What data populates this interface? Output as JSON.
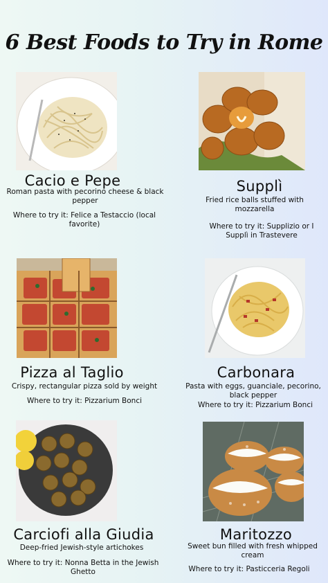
{
  "title": "6 Best Foods to Try in Rome",
  "items": [
    {
      "name": "Cacio e Pepe",
      "desc": "Roman pasta with pecorino cheese & black pepper",
      "where": "Where to try it: Felice a Testaccio (local favorite)"
    },
    {
      "name": "Supplì",
      "desc": "Fried rice balls stuffed with mozzarella",
      "where": "Where to try it: Supplizio or I Supplì in Trastevere"
    },
    {
      "name": "Pizza al Taglio",
      "desc": "Crispy, rectangular pizza sold by weight",
      "where": "Where to try it: Pizzarium Bonci"
    },
    {
      "name": "Carbonara",
      "desc": "Pasta with eggs, guanciale, pecorino, black pepper",
      "where": "Where to try it: Pizzarium Bonci"
    },
    {
      "name": "Carciofi alla Giudia",
      "desc": "Deep-fried Jewish-style artichokes",
      "where": "Where to try it: Nonna Betta in the Jewish Ghetto"
    },
    {
      "name": "Maritozzo",
      "desc": "Sweet bun filled with fresh whipped cream",
      "where": "Where to try it: Pasticceria Regoli"
    }
  ]
}
